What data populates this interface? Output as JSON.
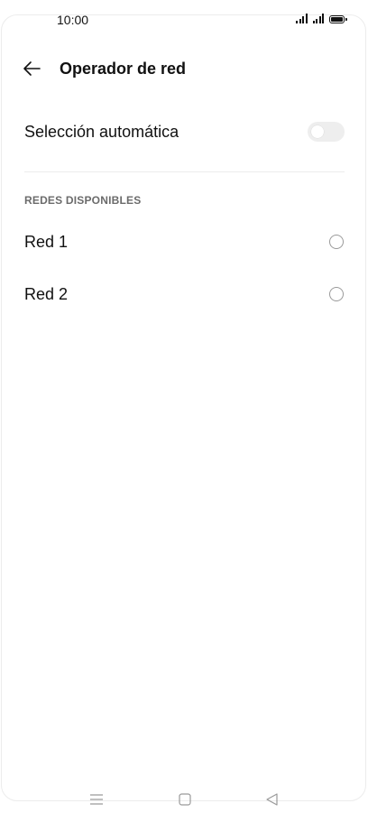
{
  "status_bar": {
    "time": "10:00",
    "icons": [
      "signal-icon",
      "signal-icon",
      "battery-icon"
    ]
  },
  "header": {
    "title": "Operador de red",
    "back_icon": "back-arrow-icon"
  },
  "auto_selection": {
    "label": "Selección automática",
    "toggle_on": false
  },
  "available_networks": {
    "section_title": "REDES DISPONIBLES",
    "items": [
      {
        "label": "Red 1",
        "selected": false
      },
      {
        "label": "Red 2",
        "selected": false
      }
    ]
  },
  "nav_bar": {
    "icons": [
      "menu-icon",
      "home-icon",
      "back-icon"
    ]
  },
  "colors": {
    "background": "#ffffff",
    "text": "#111111",
    "section_header": "#6b6b6b",
    "toggle_off": "#eeeeee",
    "radio_border": "#9a9a9a"
  }
}
